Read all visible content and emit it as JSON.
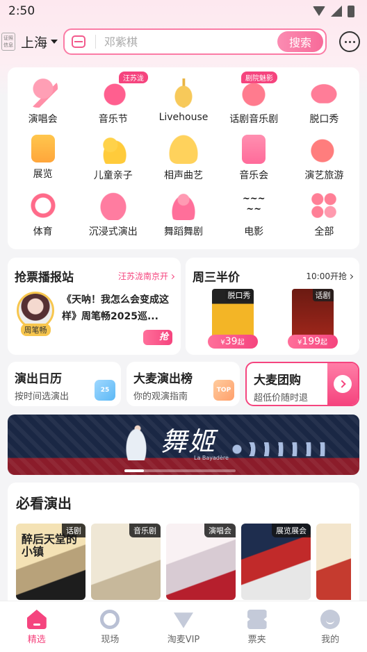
{
  "status_bar": {
    "time": "2:50"
  },
  "header": {
    "cert_badge": "证照信息",
    "city": "上海",
    "search_placeholder": "邓紫棋",
    "search_button": "搜索"
  },
  "categories": [
    {
      "label": "演唱会",
      "icon": "microphone-icon",
      "tag": ""
    },
    {
      "label": "音乐节",
      "icon": "rock-hand-icon",
      "tag": "汪苏泷"
    },
    {
      "label": "Livehouse",
      "icon": "guitar-icon",
      "tag": ""
    },
    {
      "label": "话剧音乐剧",
      "icon": "drama-mask-icon",
      "tag": "剧院魅影"
    },
    {
      "label": "脱口秀",
      "icon": "lips-icon",
      "tag": ""
    },
    {
      "label": "展览",
      "icon": "portrait-frame-icon",
      "tag": ""
    },
    {
      "label": "儿童亲子",
      "icon": "duck-icon",
      "tag": ""
    },
    {
      "label": "相声曲艺",
      "icon": "folding-fan-icon",
      "tag": ""
    },
    {
      "label": "音乐会",
      "icon": "piano-icon",
      "tag": ""
    },
    {
      "label": "演艺旅游",
      "icon": "palm-tree-icon",
      "tag": ""
    },
    {
      "label": "体育",
      "icon": "soccer-ball-icon",
      "tag": ""
    },
    {
      "label": "沉浸式演出",
      "icon": "vr-headset-icon",
      "tag": ""
    },
    {
      "label": "舞蹈舞剧",
      "icon": "dancer-icon",
      "tag": ""
    },
    {
      "label": "电影",
      "icon": "movie-calligraphy-icon",
      "tag": ""
    },
    {
      "label": "全部",
      "icon": "all-grid-icon",
      "tag": ""
    }
  ],
  "ticket_news": {
    "title": "抢票播报站",
    "link": "汪苏泷南京开",
    "artist": "周笔畅",
    "headline": "《天呐！我怎么会变成这样》周笔畅2025巡...",
    "badge": "抢"
  },
  "wednesday_deal": {
    "title": "周三半价",
    "time": "10:00开抢",
    "items": [
      {
        "tag": "脱口秀",
        "price": "39",
        "currency": "¥",
        "suffix": "起"
      },
      {
        "tag": "话剧",
        "price": "199",
        "currency": "¥",
        "suffix": "起"
      }
    ]
  },
  "quick_links": [
    {
      "title": "演出日历",
      "sub": "按时间选演出",
      "icon_text": "25"
    },
    {
      "title": "大麦演出榜",
      "sub": "你的观演指南",
      "icon_text": "TOP"
    },
    {
      "title": "大麦团购",
      "sub": "超低价随时退"
    }
  ],
  "banner": {
    "title": "舞姬",
    "subtitle": "La Bayadère"
  },
  "must_see": {
    "title": "必看演出",
    "shows": [
      {
        "tag": "话剧",
        "poster_text": "醉后天堂的小镇"
      },
      {
        "tag": "音乐剧",
        "poster_text": ""
      },
      {
        "tag": "演唱会",
        "poster_text": ""
      },
      {
        "tag": "展览展会",
        "poster_text": ""
      },
      {
        "tag": "",
        "poster_text": ""
      }
    ]
  },
  "tabbar": [
    {
      "label": "精选",
      "active": true
    },
    {
      "label": "现场",
      "active": false
    },
    {
      "label": "淘麦VIP",
      "active": false
    },
    {
      "label": "票夹",
      "active": false
    },
    {
      "label": "我的",
      "active": false
    }
  ],
  "colors": {
    "accent": "#f5447e",
    "accent_light": "#fb8cb2"
  }
}
